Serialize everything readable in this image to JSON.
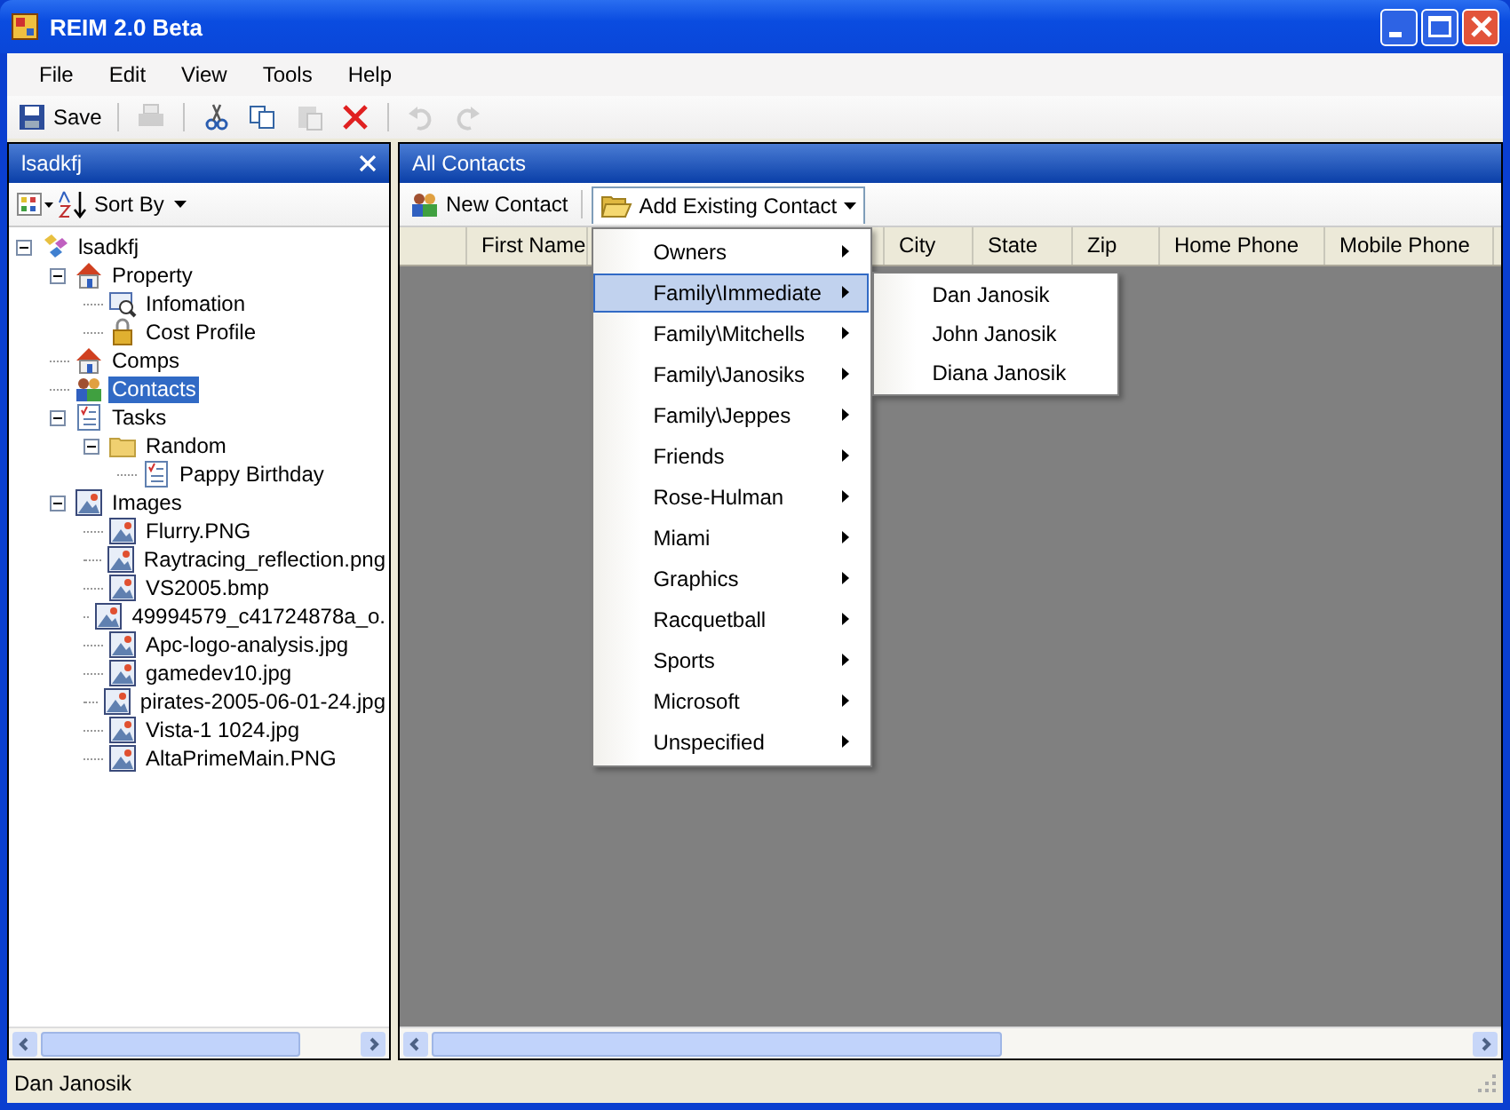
{
  "window": {
    "title": "REIM 2.0 Beta"
  },
  "menu_bar": [
    "File",
    "Edit",
    "View",
    "Tools",
    "Help"
  ],
  "toolbar": [
    {
      "kind": "save",
      "label": "Save",
      "disabled": false
    },
    {
      "kind": "print",
      "disabled": true
    },
    {
      "kind": "cut",
      "disabled": false
    },
    {
      "kind": "copy",
      "disabled": false
    },
    {
      "kind": "paste",
      "disabled": true
    },
    {
      "kind": "delete",
      "disabled": false
    },
    {
      "kind": "undo",
      "disabled": true
    },
    {
      "kind": "redo",
      "disabled": true
    }
  ],
  "left_panel": {
    "title": "lsadkfj",
    "sort_label": "Sort By",
    "tree": [
      {
        "label": "lsadkfj",
        "kind": "root",
        "expanded": true,
        "selected": false,
        "children": [
          {
            "label": "Property",
            "kind": "house",
            "expanded": true,
            "selected": false,
            "children": [
              {
                "label": "Infomation",
                "kind": "info",
                "selected": false
              },
              {
                "label": "Cost Profile",
                "kind": "lock",
                "selected": false
              }
            ]
          },
          {
            "label": "Comps",
            "kind": "house",
            "selected": false
          },
          {
            "label": "Contacts",
            "kind": "contacts",
            "selected": true
          },
          {
            "label": "Tasks",
            "kind": "tasks",
            "expanded": true,
            "selected": false,
            "children": [
              {
                "label": "Random",
                "kind": "folder",
                "expanded": true,
                "selected": false,
                "children": [
                  {
                    "label": "Pappy Birthday",
                    "kind": "tasks",
                    "selected": false
                  }
                ]
              }
            ]
          },
          {
            "label": "Images",
            "kind": "image",
            "expanded": true,
            "selected": false,
            "children": [
              {
                "label": "Flurry.PNG",
                "kind": "image",
                "selected": false
              },
              {
                "label": "Raytracing_reflection.png",
                "kind": "image",
                "selected": false
              },
              {
                "label": "VS2005.bmp",
                "kind": "image",
                "selected": false
              },
              {
                "label": "49994579_c41724878a_o.",
                "kind": "image",
                "selected": false
              },
              {
                "label": "Apc-logo-analysis.jpg",
                "kind": "image",
                "selected": false
              },
              {
                "label": "gamedev10.jpg",
                "kind": "image",
                "selected": false
              },
              {
                "label": "pirates-2005-06-01-24.jpg",
                "kind": "image",
                "selected": false
              },
              {
                "label": "Vista-1 1024.jpg",
                "kind": "image",
                "selected": false
              },
              {
                "label": "AltaPrimeMain.PNG",
                "kind": "image",
                "selected": false
              }
            ]
          }
        ]
      }
    ]
  },
  "right_panel": {
    "title": "All Contacts",
    "new_contact": "New Contact",
    "add_existing": "Add Existing Contact",
    "columns": [
      {
        "label": "First Name",
        "kind": "text"
      },
      {
        "kind": "hidden"
      },
      {
        "label": "City",
        "kind": "text"
      },
      {
        "label": "State",
        "kind": "text"
      },
      {
        "label": "Zip",
        "kind": "text"
      },
      {
        "label": "Home Phone",
        "kind": "text"
      },
      {
        "label": "Mobile Phone",
        "kind": "text"
      }
    ],
    "dropdown": [
      {
        "label": "Owners",
        "selected": false
      },
      {
        "label": "Family\\Immediate",
        "selected": true,
        "children": [
          "Dan Janosik",
          "John Janosik",
          "Diana Janosik"
        ]
      },
      {
        "label": "Family\\Mitchells",
        "selected": false
      },
      {
        "label": "Family\\Janosiks",
        "selected": false
      },
      {
        "label": "Family\\Jeppes",
        "selected": false
      },
      {
        "label": "Friends",
        "selected": false
      },
      {
        "label": "Rose-Hulman",
        "selected": false
      },
      {
        "label": "Miami",
        "selected": false
      },
      {
        "label": "Graphics",
        "selected": false
      },
      {
        "label": "Racquetball",
        "selected": false
      },
      {
        "label": "Sports",
        "selected": false
      },
      {
        "label": "Microsoft",
        "selected": false
      },
      {
        "label": "Unspecified",
        "selected": false
      }
    ]
  },
  "status_bar": "Dan Janosik"
}
